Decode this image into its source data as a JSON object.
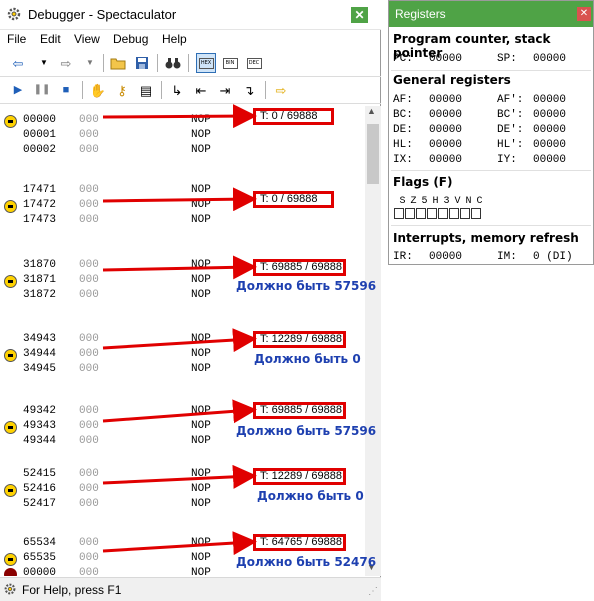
{
  "debugger": {
    "title": "Debugger - Spectaculator",
    "menu": [
      "File",
      "Edit",
      "View",
      "Debug",
      "Help"
    ],
    "toolbar_icons": [
      "back-arrow-icon",
      "dropdown-icon",
      "forward-arrow-icon",
      "dropdown-icon",
      "open-folder-icon",
      "save-icon",
      "find-binoculars-icon",
      "hex-view-icon",
      "bin-view-icon",
      "dec-view-icon"
    ],
    "toolbar2_icons": [
      "run-icon",
      "pause-icon",
      "stop-icon",
      "hand-icon",
      "step-icon",
      "step-over-icon",
      "step-into-icon",
      "step-out-icon",
      "run-to-icon",
      "go-to-pc-icon"
    ],
    "rows": [
      {
        "addr": "00000",
        "byte": "000",
        "mnem": "NOP",
        "marker": "pc"
      },
      {
        "addr": "00001",
        "byte": "000",
        "mnem": "NOP",
        "marker": ""
      },
      {
        "addr": "00002",
        "byte": "000",
        "mnem": "NOP",
        "marker": ""
      },
      {
        "addr": "17471",
        "byte": "000",
        "mnem": "NOP",
        "marker": ""
      },
      {
        "addr": "17472",
        "byte": "000",
        "mnem": "NOP",
        "marker": "pc"
      },
      {
        "addr": "17473",
        "byte": "000",
        "mnem": "NOP",
        "marker": ""
      },
      {
        "addr": "31870",
        "byte": "000",
        "mnem": "NOP",
        "marker": ""
      },
      {
        "addr": "31871",
        "byte": "000",
        "mnem": "NOP",
        "marker": "pc"
      },
      {
        "addr": "31872",
        "byte": "000",
        "mnem": "NOP",
        "marker": ""
      },
      {
        "addr": "34943",
        "byte": "000",
        "mnem": "NOP",
        "marker": ""
      },
      {
        "addr": "34944",
        "byte": "000",
        "mnem": "NOP",
        "marker": "pc"
      },
      {
        "addr": "34945",
        "byte": "000",
        "mnem": "NOP",
        "marker": ""
      },
      {
        "addr": "49342",
        "byte": "000",
        "mnem": "NOP",
        "marker": ""
      },
      {
        "addr": "49343",
        "byte": "000",
        "mnem": "NOP",
        "marker": "pc"
      },
      {
        "addr": "49344",
        "byte": "000",
        "mnem": "NOP",
        "marker": ""
      },
      {
        "addr": "52415",
        "byte": "000",
        "mnem": "NOP",
        "marker": ""
      },
      {
        "addr": "52416",
        "byte": "000",
        "mnem": "NOP",
        "marker": "pc"
      },
      {
        "addr": "52417",
        "byte": "000",
        "mnem": "NOP",
        "marker": ""
      },
      {
        "addr": "65534",
        "byte": "000",
        "mnem": "NOP",
        "marker": ""
      },
      {
        "addr": "65535",
        "byte": "000",
        "mnem": "NOP",
        "marker": "pc"
      },
      {
        "addr": "00000",
        "byte": "000",
        "mnem": "NOP",
        "marker": "stop"
      }
    ],
    "annotations": [
      {
        "tstates": "T: 0 / 69888",
        "note": ""
      },
      {
        "tstates": "T: 0 / 69888",
        "note": ""
      },
      {
        "tstates": "T: 69885 / 69888",
        "note": "Должно быть 57596"
      },
      {
        "tstates": "T: 12289 / 69888",
        "note": "Должно быть 0"
      },
      {
        "tstates": "T: 69885 / 69888",
        "note": "Должно быть 57596"
      },
      {
        "tstates": "T: 12289 / 69888",
        "note": "Должно быть 0"
      },
      {
        "tstates": "T: 64765 / 69888",
        "note": "Должно быть 52476"
      }
    ],
    "status": "For Help, press F1"
  },
  "registers": {
    "title": "Registers",
    "pc_section": "Program counter, stack pointer",
    "pc_label": "PC:",
    "pc_value": "00000",
    "sp_label": "SP:",
    "sp_value": "00000",
    "general_section": "General registers",
    "general": [
      {
        "l": "AF:",
        "lv": "00000",
        "r": "AF':",
        "rv": "00000"
      },
      {
        "l": "BC:",
        "lv": "00000",
        "r": "BC':",
        "rv": "00000"
      },
      {
        "l": "DE:",
        "lv": "00000",
        "r": "DE':",
        "rv": "00000"
      },
      {
        "l": "HL:",
        "lv": "00000",
        "r": "HL':",
        "rv": "00000"
      },
      {
        "l": "IX:",
        "lv": "00000",
        "r": "IY:",
        "rv": "00000"
      }
    ],
    "flags_section": "Flags (F)",
    "flag_bits": [
      "S",
      "Z",
      "5",
      "H",
      "3",
      "V",
      "N",
      "C"
    ],
    "interrupts_section": "Interrupts, memory refresh",
    "ir_label": "IR:",
    "ir_value": "00000",
    "im_label": "IM:",
    "im_value": "0 (DI)"
  },
  "colors": {
    "accent_green": "#4fa346",
    "annotation_red": "#e00000",
    "note_blue": "#1e40b0"
  }
}
